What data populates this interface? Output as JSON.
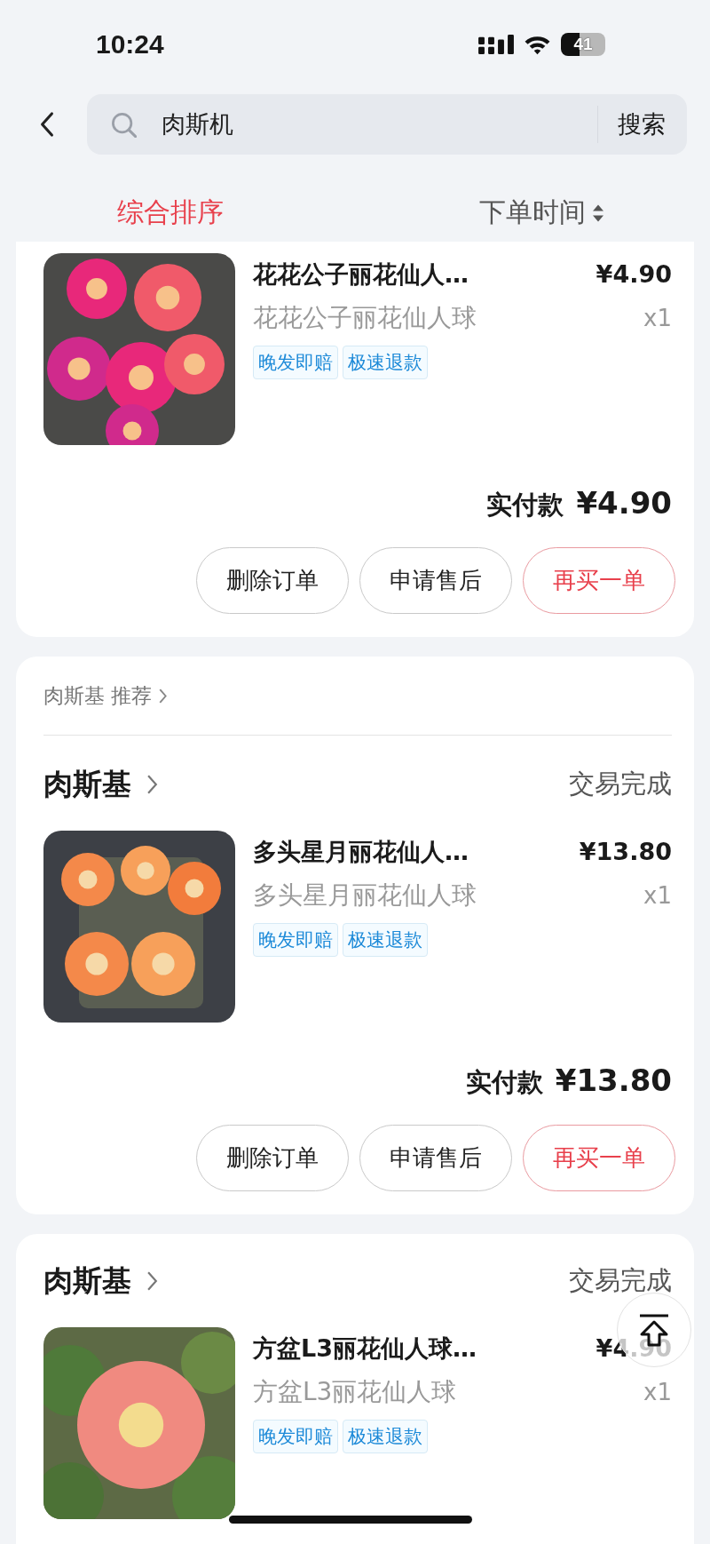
{
  "status_bar": {
    "time": "10:24",
    "battery": "41"
  },
  "search": {
    "value": "肉斯机",
    "button": "搜索"
  },
  "sort_tabs": [
    {
      "label": "综合排序",
      "selected": true,
      "sortable": false
    },
    {
      "label": "下单时间",
      "selected": false,
      "sortable": true
    }
  ],
  "orders": [
    {
      "item": {
        "kind": "picture",
        "title": "花花公子丽花仙人…",
        "price": "¥4.90",
        "spec": "花花公子丽花仙人球",
        "quantity": "x1",
        "tags": [
          "晚发即赔",
          "极速退款"
        ]
      },
      "total_label": "实付款",
      "total": "¥4.90",
      "actions": [
        {
          "label": "删除订单",
          "kind": "normal"
        },
        {
          "label": "申请售后",
          "kind": "normal"
        },
        {
          "label": "再买一单",
          "kind": "primary"
        }
      ]
    },
    {
      "recommend": "肉斯基 推荐",
      "shop": "肉斯基",
      "status": "交易完成",
      "item": {
        "kind": "picture",
        "title": "多头星月丽花仙人…",
        "price": "¥13.80",
        "spec": "多头星月丽花仙人球",
        "quantity": "x1",
        "tags": [
          "晚发即赔",
          "极速退款"
        ]
      },
      "total_label": "实付款",
      "total": "¥13.80",
      "actions": [
        {
          "label": "删除订单",
          "kind": "normal"
        },
        {
          "label": "申请售后",
          "kind": "normal"
        },
        {
          "label": "再买一单",
          "kind": "primary"
        }
      ]
    },
    {
      "shop": "肉斯基",
      "status": "交易完成",
      "item": {
        "kind": "picture",
        "title": "方盆L3丽花仙人球…",
        "price": "¥4.90",
        "spec": "方盆L3丽花仙人球",
        "quantity": "x1",
        "tags": [
          "晚发即赔",
          "极速退款"
        ]
      }
    }
  ]
}
